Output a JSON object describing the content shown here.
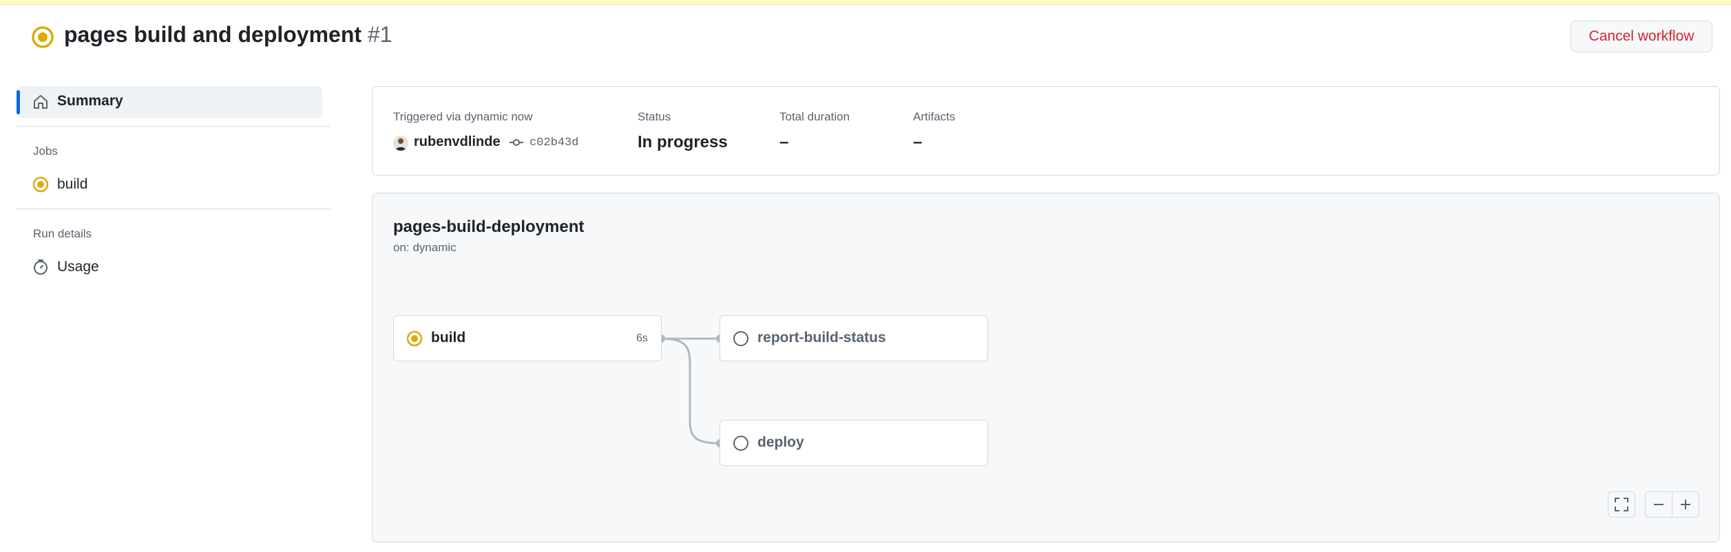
{
  "header": {
    "title": "pages build and deployment",
    "run_number": "#1",
    "cancel_label": "Cancel workflow"
  },
  "sidebar": {
    "summary_label": "Summary",
    "jobs_heading": "Jobs",
    "jobs": [
      {
        "label": "build",
        "status": "in_progress"
      }
    ],
    "run_details_heading": "Run details",
    "usage_label": "Usage"
  },
  "summary": {
    "trigger_label": "Triggered via dynamic now",
    "actor": "rubenvdlinde",
    "commit": "c02b43d",
    "status_label": "Status",
    "status_value": "In progress",
    "duration_label": "Total duration",
    "duration_value": "–",
    "artifacts_label": "Artifacts",
    "artifacts_value": "–"
  },
  "graph": {
    "workflow_name": "pages-build-deployment",
    "trigger": "on: dynamic",
    "jobs": [
      {
        "name": "build",
        "duration": "6s",
        "status": "in_progress"
      },
      {
        "name": "report-build-status",
        "status": "queued"
      },
      {
        "name": "deploy",
        "status": "queued"
      }
    ]
  },
  "icons": {
    "status_in_progress": "in-progress-icon",
    "status_queued": "queued-icon",
    "summary": "home-icon",
    "usage": "stopwatch-icon",
    "commit": "git-commit-icon",
    "fullscreen": "fullscreen-icon",
    "zoom_out": "zoom-out-icon",
    "zoom_in": "zoom-in-icon"
  },
  "colors": {
    "in_progress": "#dbab0a",
    "danger": "#d1242f",
    "accent": "#0969da"
  }
}
